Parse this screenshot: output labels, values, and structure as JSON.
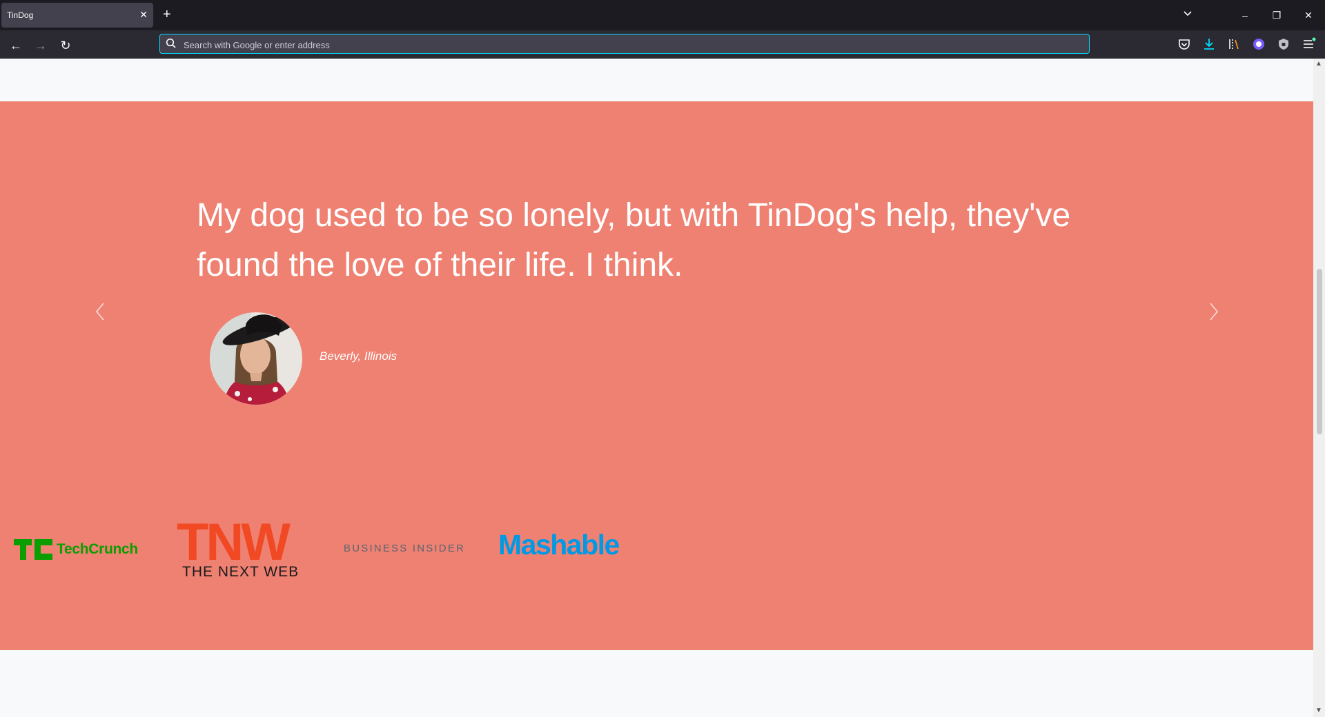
{
  "browser": {
    "tab_title": "TinDog",
    "tab_close": "✕",
    "new_tab": "+",
    "url_placeholder": "Search with Google or enter address",
    "window_controls": {
      "list_tabs": "⌄",
      "minimize": "–",
      "restore": "❐",
      "close": "✕"
    },
    "nav": {
      "back": "←",
      "forward": "→",
      "reload": "↻"
    }
  },
  "testimonial": {
    "quote": "My dog used to be so lonely, but with TinDog's help, they've found the love of their life. I think.",
    "location": "Beverly, Illinois"
  },
  "press": {
    "techcrunch": "TechCrunch",
    "tnw_mark": "TNW",
    "tnw_name": "THE NEXT WEB",
    "business_insider": "BUSINESS INSIDER",
    "mashable": "Mashable"
  },
  "colors": {
    "section_bg": "#ef8172",
    "page_bg": "#f8f9fa",
    "techcrunch": "#0a9e01",
    "tnw": "#f04923",
    "mashable": "#0099e5",
    "business_insider": "#5a6470"
  }
}
